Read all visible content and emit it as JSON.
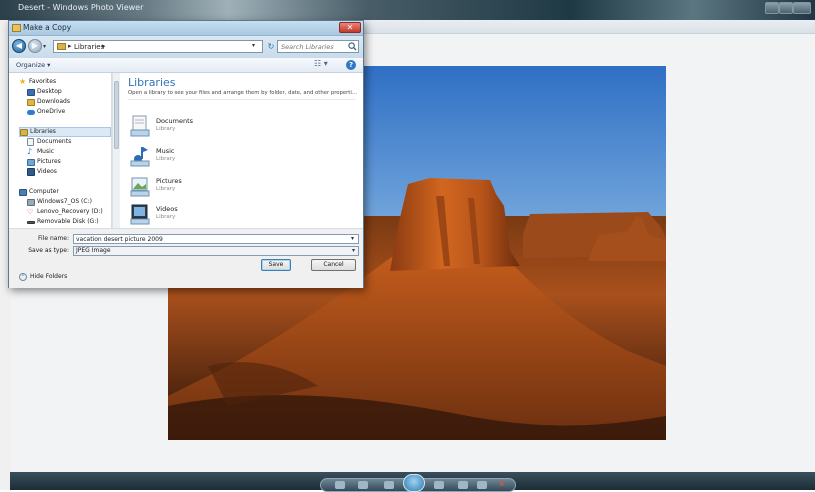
{
  "viewer": {
    "title": "Desert - Windows Photo Viewer"
  },
  "dialog": {
    "title": "Make a Copy",
    "address": {
      "crumb": "Libraries",
      "separator": "▸"
    },
    "search_placeholder": "Search Libraries",
    "organize_label": "Organize ▾",
    "nav": {
      "favorites": [
        {
          "label": "Favorites",
          "icon": "star-icon"
        },
        {
          "label": "Desktop",
          "icon": "desktop-icon"
        },
        {
          "label": "Downloads",
          "icon": "downloads-icon"
        },
        {
          "label": "OneDrive",
          "icon": "cloud-icon"
        }
      ],
      "libraries": [
        {
          "label": "Libraries",
          "icon": "libraries-icon"
        },
        {
          "label": "Documents",
          "icon": "documents-icon"
        },
        {
          "label": "Music",
          "icon": "music-icon"
        },
        {
          "label": "Pictures",
          "icon": "pictures-icon"
        },
        {
          "label": "Videos",
          "icon": "videos-icon"
        }
      ],
      "computer": [
        {
          "label": "Computer",
          "icon": "computer-icon"
        },
        {
          "label": "Windows7_OS (C:)",
          "icon": "drive-icon"
        },
        {
          "label": "Lenovo_Recovery (D:)",
          "icon": "recovery-drive-icon"
        },
        {
          "label": "Removable Disk (G:)",
          "icon": "removable-disk-icon"
        }
      ]
    },
    "content": {
      "header": "Libraries",
      "description": "Open a library to see your files and arrange them by folder, date, and other properti...",
      "items": [
        {
          "name": "Documents",
          "type": "Library",
          "icon": "documents-library-icon"
        },
        {
          "name": "Music",
          "type": "Library",
          "icon": "music-library-icon"
        },
        {
          "name": "Pictures",
          "type": "Library",
          "icon": "pictures-library-icon"
        },
        {
          "name": "Videos",
          "type": "Library",
          "icon": "videos-library-icon"
        }
      ]
    },
    "fields": {
      "filename_label": "File name:",
      "filename_value": "vacation desert picture 2009",
      "savetype_label": "Save as type:",
      "savetype_value": "JPEG Image"
    },
    "hide_folders_label": "Hide Folders",
    "save_label": "Save",
    "cancel_label": "Cancel"
  },
  "colors": {
    "accent": "#2e75b6",
    "close_red": "#c23b2b"
  }
}
